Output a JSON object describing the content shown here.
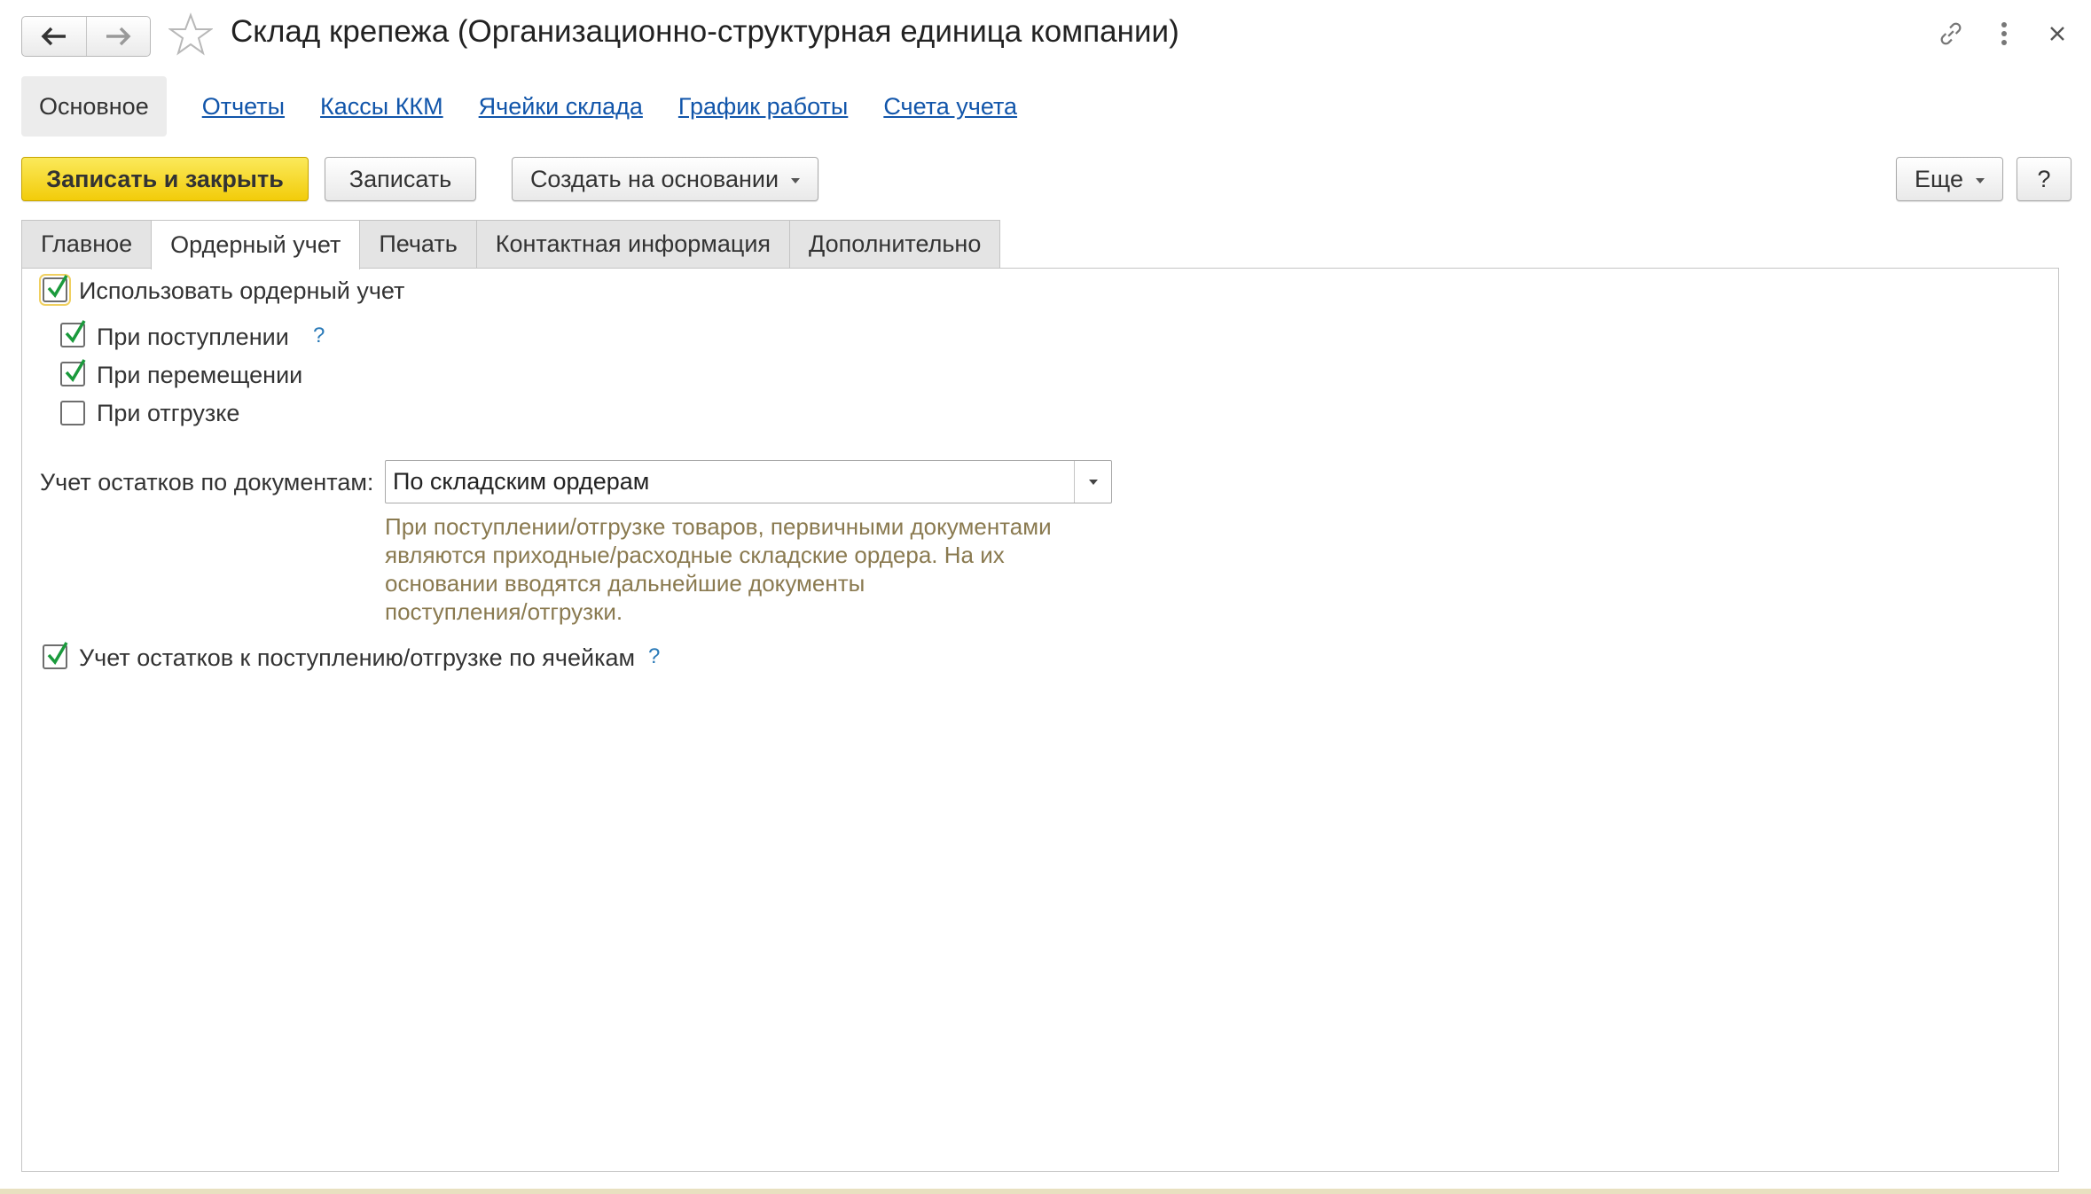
{
  "window": {
    "title": "Склад крепежа (Организационно-структурная единица компании)",
    "icons": [
      "link-icon",
      "more-vertical-icon",
      "close-icon"
    ]
  },
  "link_bar": {
    "active": "Основное",
    "links": [
      "Отчеты",
      "Кассы ККМ",
      "Ячейки склада",
      "График работы",
      "Счета учета"
    ]
  },
  "toolbar": {
    "save_close": "Записать и закрыть",
    "save": "Записать",
    "create_based": "Создать на основании",
    "more": "Еще",
    "help": "?"
  },
  "tabs": [
    "Главное",
    "Ордерный учет",
    "Печать",
    "Контактная информация",
    "Дополнительно"
  ],
  "active_tab": "Ордерный учет",
  "form": {
    "use_order": {
      "label": "Использовать ордерный учет",
      "checked": true
    },
    "on_receipt": {
      "label": "При поступлении",
      "checked": true,
      "help": "?"
    },
    "on_move": {
      "label": "При перемещении",
      "checked": true
    },
    "on_shipment": {
      "label": "При отгрузке",
      "checked": false
    },
    "balance_label": "Учет остатков по документам:",
    "balance_value": "По складским ордерам",
    "hint_lines": [
      "При поступлении/отгрузке товаров, первичными документами",
      "являются приходные/расходные складские ордера. На их",
      "основании вводятся дальнейшие документы",
      "поступления/отгрузки."
    ],
    "cells": {
      "label": "Учет остатков к поступлению/отгрузке по ячейкам",
      "checked": true,
      "help": "?"
    }
  },
  "colors": {
    "accent_yellow": "#f2cc0a",
    "link_blue": "#1155aa",
    "hint": "#8a7a50",
    "check_green": "#1a9a3c"
  }
}
